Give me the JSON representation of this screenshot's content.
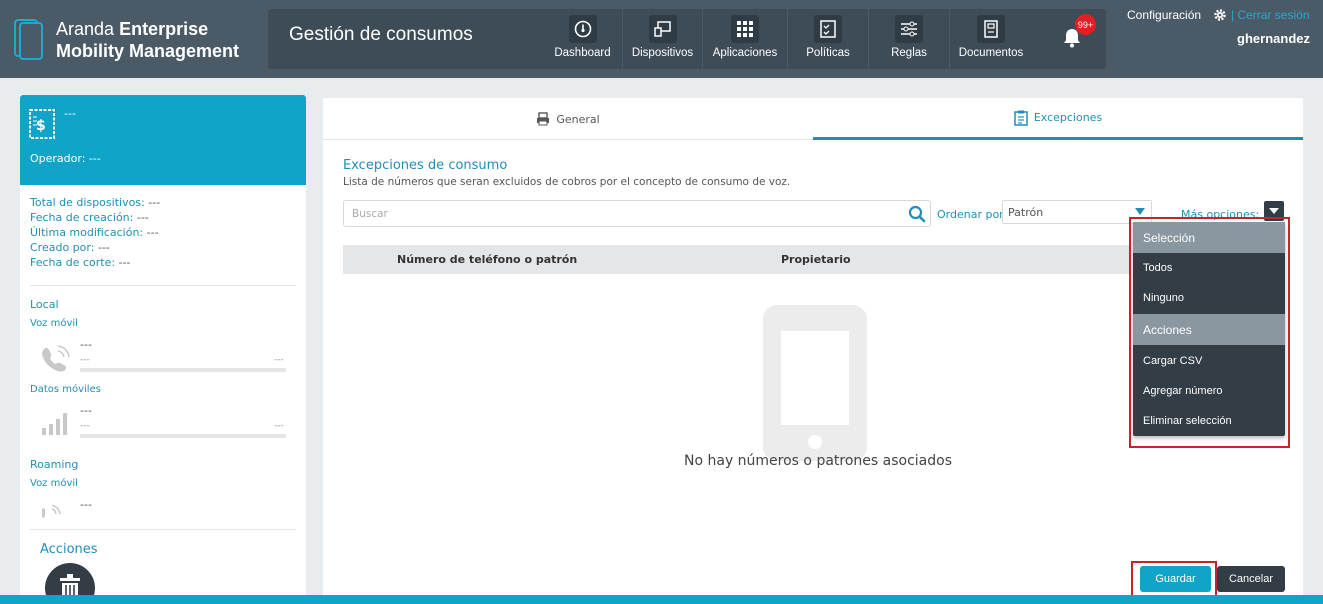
{
  "app": {
    "name_light": "Aranda",
    "name_bold_1": "Enterprise",
    "name_bold_2": "Mobility Management"
  },
  "header": {
    "module_title": "Gestión de consumos",
    "nav": [
      {
        "label": "Dashboard",
        "icon": "dashboard-icon"
      },
      {
        "label": "Dispositivos",
        "icon": "devices-icon"
      },
      {
        "label": "Aplicaciones",
        "icon": "apps-grid-icon"
      },
      {
        "label": "Políticas",
        "icon": "policies-icon"
      },
      {
        "label": "Reglas",
        "icon": "rules-icon"
      },
      {
        "label": "Documentos",
        "icon": "documents-icon"
      }
    ],
    "notifications_badge": "99+",
    "config_label": "Configuración",
    "separator": "|",
    "logout_label": "Cerrar sesión",
    "username": "ghernandez"
  },
  "sidebar": {
    "name": "---",
    "operator_label": "Operador:",
    "operator_value": "---",
    "info": [
      {
        "label": "Total de dispositivos:",
        "value": "---"
      },
      {
        "label": "Fecha de creación:",
        "value": "---"
      },
      {
        "label": "Última modificación:",
        "value": "---"
      },
      {
        "label": "Creado por:",
        "value": "---"
      },
      {
        "label": "Fecha de corte:",
        "value": "---"
      }
    ],
    "local_label": "Local",
    "voz_movil_label": "Voz móvil",
    "voz_value": "---",
    "voz_min": "---",
    "voz_max": "---",
    "datos_label": "Datos móviles",
    "datos_value": "---",
    "datos_min": "---",
    "datos_max": "---",
    "roaming_label": "Roaming",
    "roaming_voz_label": "Voz móvil",
    "roaming_value": "---",
    "acciones_label": "Acciones"
  },
  "tabs": [
    {
      "label": "General",
      "active": false
    },
    {
      "label": "Excepciones",
      "active": true
    }
  ],
  "content": {
    "title": "Excepciones de consumo",
    "description": "Lista de números que seran excluidos de cobros por el concepto de consumo de voz.",
    "search_placeholder": "Buscar",
    "order_label": "Ordenar por",
    "order_value": "Patrón",
    "more_options_label": "Más opciones:",
    "columns": [
      "Número de teléfono o patrón",
      "Propietario"
    ],
    "empty_message": "No hay números o patrones asociados"
  },
  "dropdown": {
    "groups": [
      {
        "title": "Selección",
        "items": [
          "Todos",
          "Ninguno"
        ]
      },
      {
        "title": "Acciones",
        "items": [
          "Cargar CSV",
          "Agregar número",
          "Eliminar selección"
        ]
      }
    ]
  },
  "buttons": {
    "save": "Guardar",
    "cancel": "Cancelar"
  },
  "colors": {
    "accent": "#0fa4c8",
    "header": "#4a5a66",
    "dark": "#333d45",
    "highlight": "#c8222a"
  }
}
